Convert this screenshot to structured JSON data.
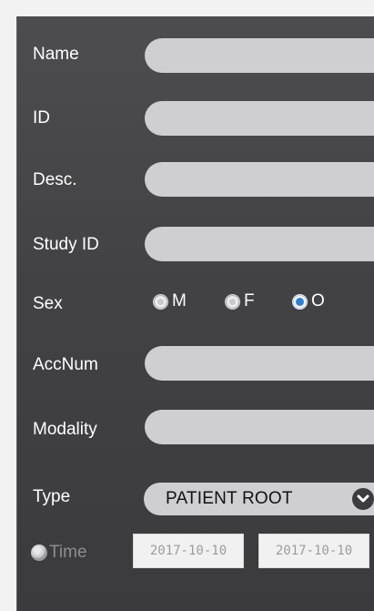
{
  "form": {
    "name_label": "Name",
    "id_label": "ID",
    "desc_label": "Desc.",
    "study_id_label": "Study ID",
    "sex_label": "Sex",
    "sex_options": [
      "M",
      "F",
      "O"
    ],
    "sex_selected": "O",
    "accnum_label": "AccNum",
    "modality_label": "Modality",
    "type_label": "Type",
    "type_value": "PATIENT ROOT",
    "time_label": "Time",
    "date_from": "2017-10-10",
    "date_to": "2017-10-10",
    "name_value": "",
    "id_value": "",
    "desc_value": "",
    "study_id_value": "",
    "accnum_value": "",
    "modality_value": ""
  },
  "colors": {
    "panel_bg": "#444447",
    "field_bg": "#cfcfd2",
    "radio_selected": "#2e7fd3",
    "time_disabled": "#8e8e92"
  }
}
